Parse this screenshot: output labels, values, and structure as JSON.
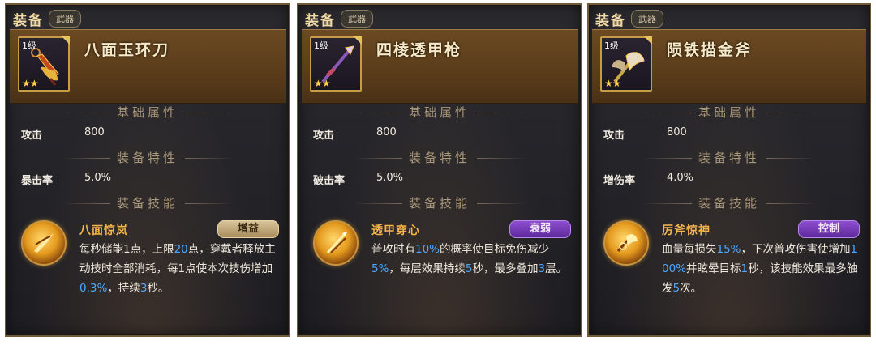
{
  "panels": [
    {
      "header": "装备",
      "tab": "武器",
      "level": "1级",
      "name": "八面玉环刀",
      "basic_header": "基础属性",
      "attr_label": "攻击",
      "attr_value": "800",
      "trait_header": "装备特性",
      "trait_label": "暴击率",
      "trait_value": "5.0%",
      "skill_header": "装备技能",
      "skill_name": "八面惊岚",
      "skill_tag": "增益",
      "desc": [
        {
          "t": "每秒储能1点，上限",
          "h": false
        },
        {
          "t": "20",
          "h": true
        },
        {
          "t": "点，穿戴者释放主动技时全部消耗，每1点使本次技伤增加",
          "h": false
        },
        {
          "t": "0.3%",
          "h": true
        },
        {
          "t": "，持续",
          "h": false
        },
        {
          "t": "3",
          "h": true
        },
        {
          "t": "秒。",
          "h": false
        }
      ],
      "colors": {
        "tag": "#c7ad7c"
      }
    },
    {
      "header": "装备",
      "tab": "武器",
      "level": "1级",
      "name": "四棱透甲枪",
      "basic_header": "基础属性",
      "attr_label": "攻击",
      "attr_value": "800",
      "trait_header": "装备特性",
      "trait_label": "破击率",
      "trait_value": "5.0%",
      "skill_header": "装备技能",
      "skill_name": "透甲穿心",
      "skill_tag": "衰弱",
      "desc": [
        {
          "t": "普攻时有",
          "h": false
        },
        {
          "t": "10%",
          "h": true
        },
        {
          "t": "的概率使目标免伤减少",
          "h": false
        },
        {
          "t": "5%",
          "h": true
        },
        {
          "t": "，每层效果持续",
          "h": false
        },
        {
          "t": "5",
          "h": true
        },
        {
          "t": "秒，最多叠加",
          "h": false
        },
        {
          "t": "3",
          "h": true
        },
        {
          "t": "层。",
          "h": false
        }
      ],
      "colors": {
        "tag": "#7b3fc0"
      }
    },
    {
      "header": "装备",
      "tab": "武器",
      "level": "1级",
      "name": "陨铁描金斧",
      "basic_header": "基础属性",
      "attr_label": "攻击",
      "attr_value": "800",
      "trait_header": "装备特性",
      "trait_label": "增伤率",
      "trait_value": "4.0%",
      "skill_header": "装备技能",
      "skill_name": "厉斧惊神",
      "skill_tag": "控制",
      "desc": [
        {
          "t": "血量每损失",
          "h": false
        },
        {
          "t": "15%",
          "h": true
        },
        {
          "t": "，下次普攻伤害使增加",
          "h": false
        },
        {
          "t": "100%",
          "h": true
        },
        {
          "t": "并眩晕目标",
          "h": false
        },
        {
          "t": "1",
          "h": true
        },
        {
          "t": "秒，该技能效果最多触发",
          "h": false
        },
        {
          "t": "5",
          "h": true
        },
        {
          "t": "次。",
          "h": false
        }
      ],
      "colors": {
        "tag": "#7b3fc0"
      }
    }
  ],
  "icons": [
    "broadsword-icon",
    "spear-icon",
    "battle-axe-icon"
  ]
}
